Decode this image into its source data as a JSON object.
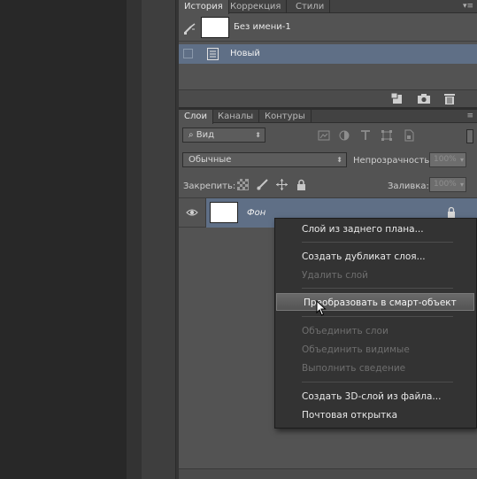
{
  "history_panel": {
    "tabs": [
      "История",
      "Коррекция",
      "Стили"
    ],
    "snapshot_name": "Без имени-1",
    "step_name": "Новый"
  },
  "layers_panel": {
    "tabs": [
      "Слои",
      "Каналы",
      "Контуры"
    ],
    "filter_kind": "Вид",
    "blend_mode": "Обычные",
    "opacity_label": "Непрозрачность:",
    "opacity_value": "100%",
    "lock_label": "Закрепить:",
    "fill_label": "Заливка:",
    "fill_value": "100%",
    "layer_name": "Фон"
  },
  "context_menu": {
    "items": [
      {
        "label": "Слой из заднего плана...",
        "enabled": true
      },
      {
        "label": "Создать дубликат слоя...",
        "enabled": true
      },
      {
        "label": "Удалить слой",
        "enabled": false
      },
      {
        "label": "Преобразовать в смарт-объект",
        "enabled": true,
        "highlighted": true
      },
      {
        "label": "Объединить слои",
        "enabled": false
      },
      {
        "label": "Объединить видимые",
        "enabled": false
      },
      {
        "label": "Выполнить сведение",
        "enabled": false
      },
      {
        "label": "Создать 3D-слой из файла...",
        "enabled": true
      },
      {
        "label": "Почтовая открытка",
        "enabled": true
      }
    ]
  },
  "colors": {
    "panel_bg": "#535353",
    "selection": "#5f6f86",
    "menu_bg": "#333333",
    "workspace": "#282828"
  }
}
